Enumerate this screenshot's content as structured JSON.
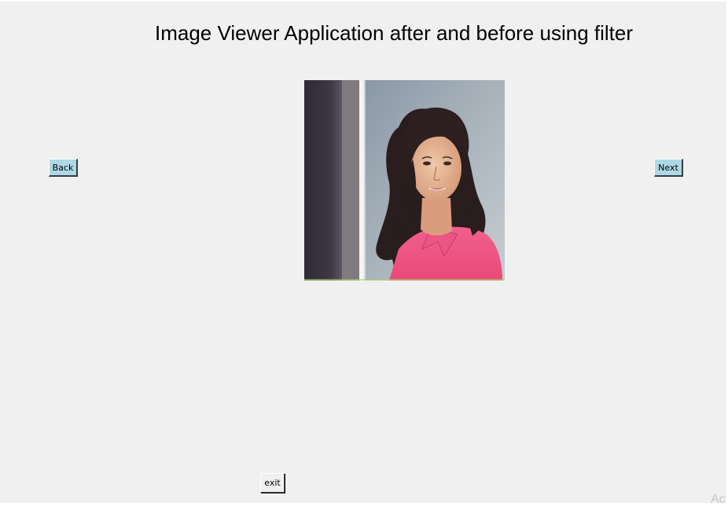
{
  "window": {
    "title": "Image Viewer Application after and before using filter"
  },
  "navigation": {
    "back_label": "Back",
    "next_label": "Next",
    "exit_label": "exit"
  },
  "image": {
    "description_icon": "portrait-photo"
  },
  "colors": {
    "nav_button_bg": "#add8e6",
    "window_bg": "#f0f0f0",
    "exit_button_bg": "#f0f0f0"
  },
  "watermark": {
    "text": "Ac"
  }
}
